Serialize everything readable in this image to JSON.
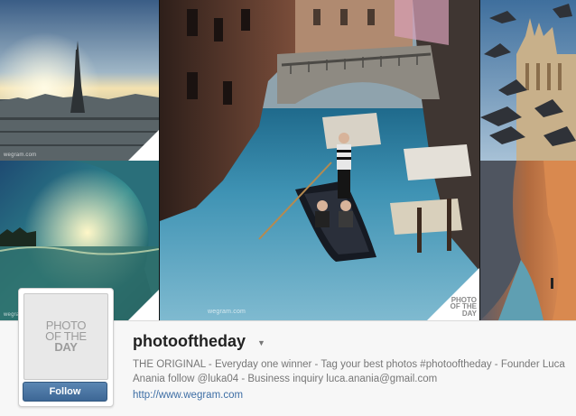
{
  "watermarks": {
    "paris": "wegram.com",
    "wave": "wegram.com",
    "venice": "wegram.com"
  },
  "corner_logo": "PHOTO OF THE DAY",
  "profile": {
    "username": "photooftheday",
    "caret_icon": "caret-down-icon",
    "avatar_text_line1": "PHOTO",
    "avatar_text_line2": "OF THE",
    "avatar_text_line3": "DAY",
    "follow_label": "Follow",
    "bio": "THE ORIGINAL - Everyday one winner - Tag your best photos #photooftheday - Founder Luca Anania follow @luka04 - Business inquiry luca.anania@gmail.com",
    "website": "http://www.wegram.com"
  },
  "colors": {
    "follow_button": "#4a73a0",
    "link": "#3d6ea5"
  }
}
